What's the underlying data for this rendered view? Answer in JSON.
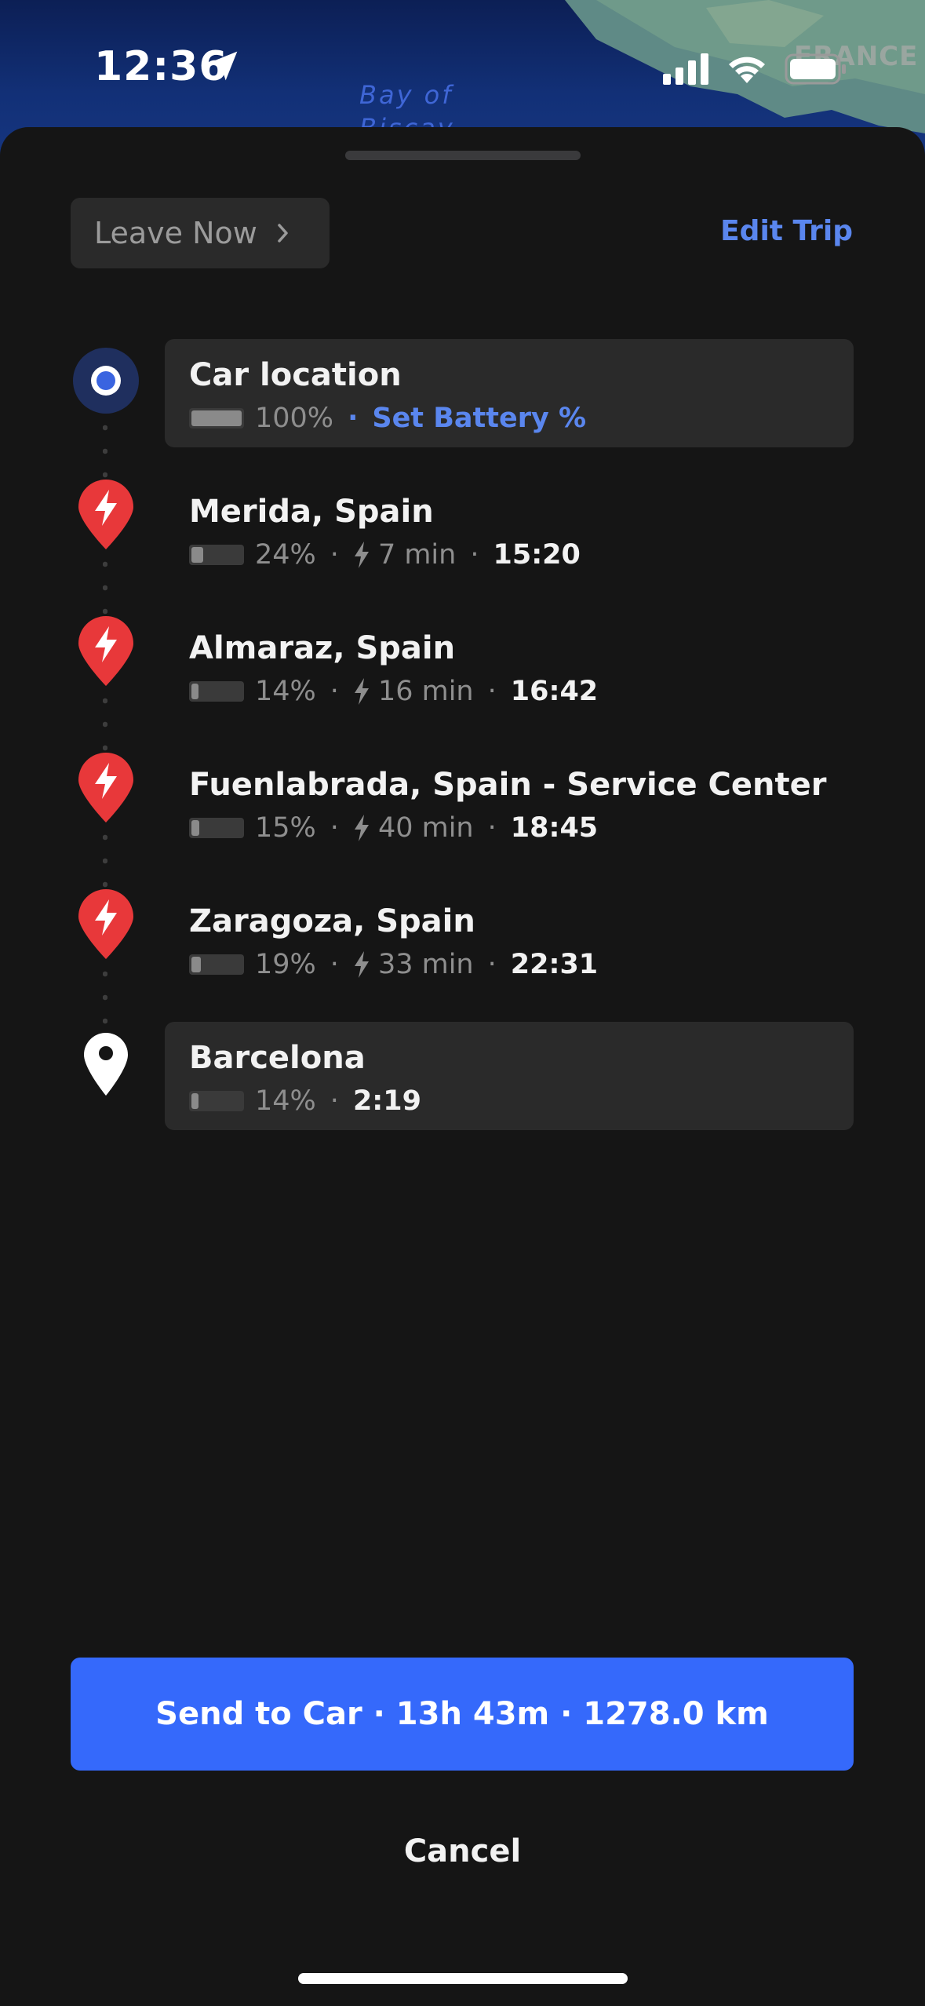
{
  "status_bar": {
    "time": "12:36",
    "icons": [
      "location-arrow-icon",
      "cellular-signal-icon",
      "wifi-icon",
      "battery-icon"
    ]
  },
  "map": {
    "labels": {
      "bay": "Bay of Biscay",
      "country": "FRANCE"
    }
  },
  "header": {
    "leave_now": "Leave Now",
    "edit_trip": "Edit Trip"
  },
  "route": {
    "stops": [
      {
        "name": "Car location",
        "battery": "100%",
        "battery_level": 1.0,
        "extra": "Set Battery %",
        "type": "origin"
      },
      {
        "name": "Merida, Spain",
        "battery": "24%",
        "battery_level": 0.24,
        "charge_time": "7 min",
        "arrival": "15:20",
        "type": "charger"
      },
      {
        "name": "Almaraz, Spain",
        "battery": "14%",
        "battery_level": 0.14,
        "charge_time": "16 min",
        "arrival": "16:42",
        "type": "charger"
      },
      {
        "name": "Fuenlabrada, Spain - Service Center",
        "battery": "15%",
        "battery_level": 0.15,
        "charge_time": "40 min",
        "arrival": "18:45",
        "type": "charger"
      },
      {
        "name": "Zaragoza, Spain",
        "battery": "19%",
        "battery_level": 0.19,
        "charge_time": "33 min",
        "arrival": "22:31",
        "type": "charger"
      },
      {
        "name": "Barcelona",
        "battery": "14%",
        "battery_level": 0.14,
        "arrival": "2:19",
        "type": "destination"
      }
    ],
    "separator": "·"
  },
  "actions": {
    "send_to_car": "Send to Car · 13h 43m · 1278.0 km",
    "cancel": "Cancel"
  },
  "colors": {
    "background": "#151515",
    "card": "#2a2a2a",
    "accent_blue": "#5a86ee",
    "primary_button": "#3569fb",
    "charger_red": "#e8383a"
  }
}
